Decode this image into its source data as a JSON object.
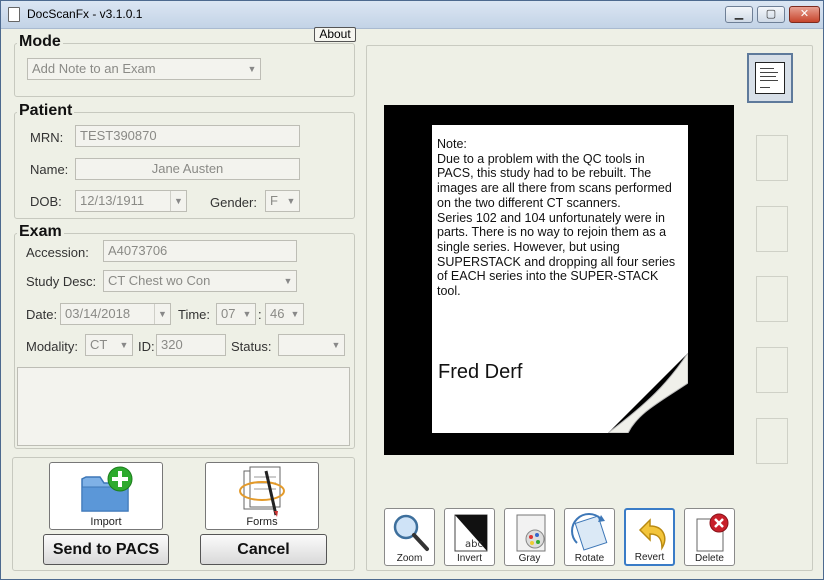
{
  "window": {
    "title": "DocScanFx  -  v3.1.0.1"
  },
  "about_label": "About",
  "mode": {
    "title": "Mode",
    "selected": "Add Note to an Exam"
  },
  "patient": {
    "title": "Patient",
    "mrn_label": "MRN:",
    "mrn": "TEST390870",
    "name_label": "Name:",
    "name": "Jane Austen",
    "dob_label": "DOB:",
    "dob": "12/13/1911",
    "gender_label": "Gender:",
    "gender": "F"
  },
  "exam": {
    "title": "Exam",
    "accession_label": "Accession:",
    "accession": "A4073706",
    "study_label": "Study Desc:",
    "study": "CT Chest wo Con",
    "date_label": "Date:",
    "date": "03/14/2018",
    "time_label": "Time:",
    "hour": "07",
    "time_sep": ":",
    "minute": "46",
    "modality_label": "Modality:",
    "modality": "CT",
    "id_label": "ID:",
    "id": "320",
    "status_label": "Status:",
    "status": ""
  },
  "buttons": {
    "import": "Import",
    "forms": "Forms",
    "send": "Send to PACS",
    "cancel": "Cancel"
  },
  "document": {
    "note": "Note:\nDue to a problem with the QC tools in PACS, this study had to be rebuilt.  The images are all there from scans performed on the two different CT scanners.\nSeries 102 and 104 unfortunately were in parts.  There is no way to rejoin them as a single series.  However, but using SUPERSTACK and dropping all four series of EACH series into the SUPER-STACK tool.",
    "signature": "Fred Derf"
  },
  "tools": {
    "zoom": "Zoom",
    "invert": "Invert",
    "gray": "Gray",
    "rotate": "Rotate",
    "revert": "Revert",
    "delete": "Delete"
  },
  "icons": {
    "import": "folder-add-icon",
    "forms": "forms-pen-icon",
    "zoom": "magnifier-icon",
    "invert": "invert-icon",
    "gray": "grayscale-icon",
    "rotate": "rotate-icon",
    "revert": "undo-arrow-icon",
    "delete": "delete-x-icon"
  },
  "colors": {
    "window_bg": "#eef0e6",
    "accent_active": "#3a7cc7",
    "add_green": "#2eaa2e",
    "delete_red": "#c8202a"
  }
}
